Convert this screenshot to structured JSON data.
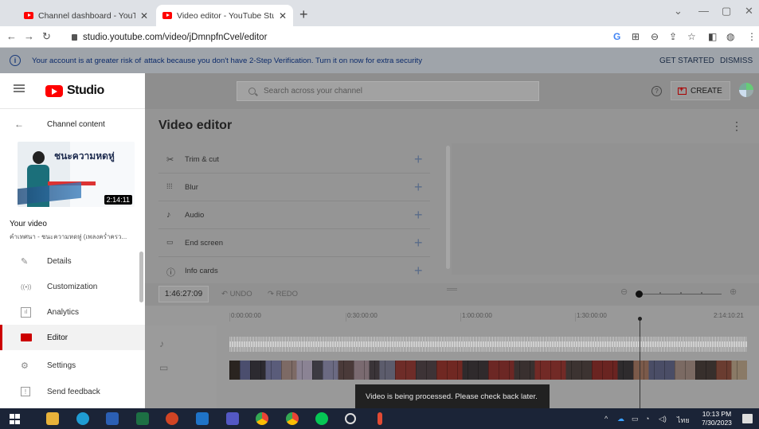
{
  "browser": {
    "tabs": [
      {
        "title": "Channel dashboard - YouTube St",
        "active": false
      },
      {
        "title": "Video editor - YouTube Studio",
        "active": true
      }
    ],
    "new_tab_label": "+",
    "url": "studio.youtube.com/video/jDmnpfnCvel/editor"
  },
  "banner": {
    "message_part1": "Your account is at greater risk of",
    "message_part2": "attack because you don't have 2-Step Verification. Turn it on now for extra security",
    "get_started": "GET STARTED",
    "dismiss": "DISMISS"
  },
  "header": {
    "logo_text": "Studio",
    "search_placeholder": "Search across your channel",
    "help_label": "?",
    "create_label": "CREATE"
  },
  "sidebar": {
    "back_label": "Channel content",
    "thumbnail": {
      "title_text": "ชนะความหดหู่",
      "duration": "2:14:11"
    },
    "your_video_label": "Your video",
    "video_title": "คำเทศนา - ชนะความหดหู่ (เพลงคร่ำครว...",
    "items": [
      {
        "label": "Details",
        "icon": "pencil-icon",
        "active": false
      },
      {
        "label": "Customization",
        "icon": "broadcast-icon",
        "active": false
      },
      {
        "label": "Analytics",
        "icon": "analytics-icon",
        "active": false
      },
      {
        "label": "Editor",
        "icon": "editor-icon",
        "active": true
      },
      {
        "label": "Settings",
        "icon": "gear-icon",
        "active": false
      },
      {
        "label": "Send feedback",
        "icon": "feedback-icon",
        "active": false
      }
    ]
  },
  "editor": {
    "title": "Video editor",
    "tools": [
      {
        "label": "Trim & cut",
        "icon": "scissors-icon"
      },
      {
        "label": "Blur",
        "icon": "blur-icon"
      },
      {
        "label": "Audio",
        "icon": "music-note-icon"
      },
      {
        "label": "End screen",
        "icon": "end-screen-icon"
      },
      {
        "label": "Info cards",
        "icon": "info-icon"
      }
    ],
    "timecode": "1:46:27:09",
    "undo_label": "UNDO",
    "redo_label": "REDO",
    "ruler": [
      "0:00:00:00",
      "0:30:00:00",
      "1:00:00:00",
      "1:30:00:00",
      "2:14:10:21"
    ],
    "toast": "Video is being processed. Please check back later."
  },
  "taskbar": {
    "lang": "ไทย",
    "time": "10:13 PM",
    "date": "7/30/2023"
  },
  "colors": {
    "accent_red": "#ff0000",
    "banner_bg": "#9fa4aa",
    "taskbar_bg": "#1b2437"
  }
}
